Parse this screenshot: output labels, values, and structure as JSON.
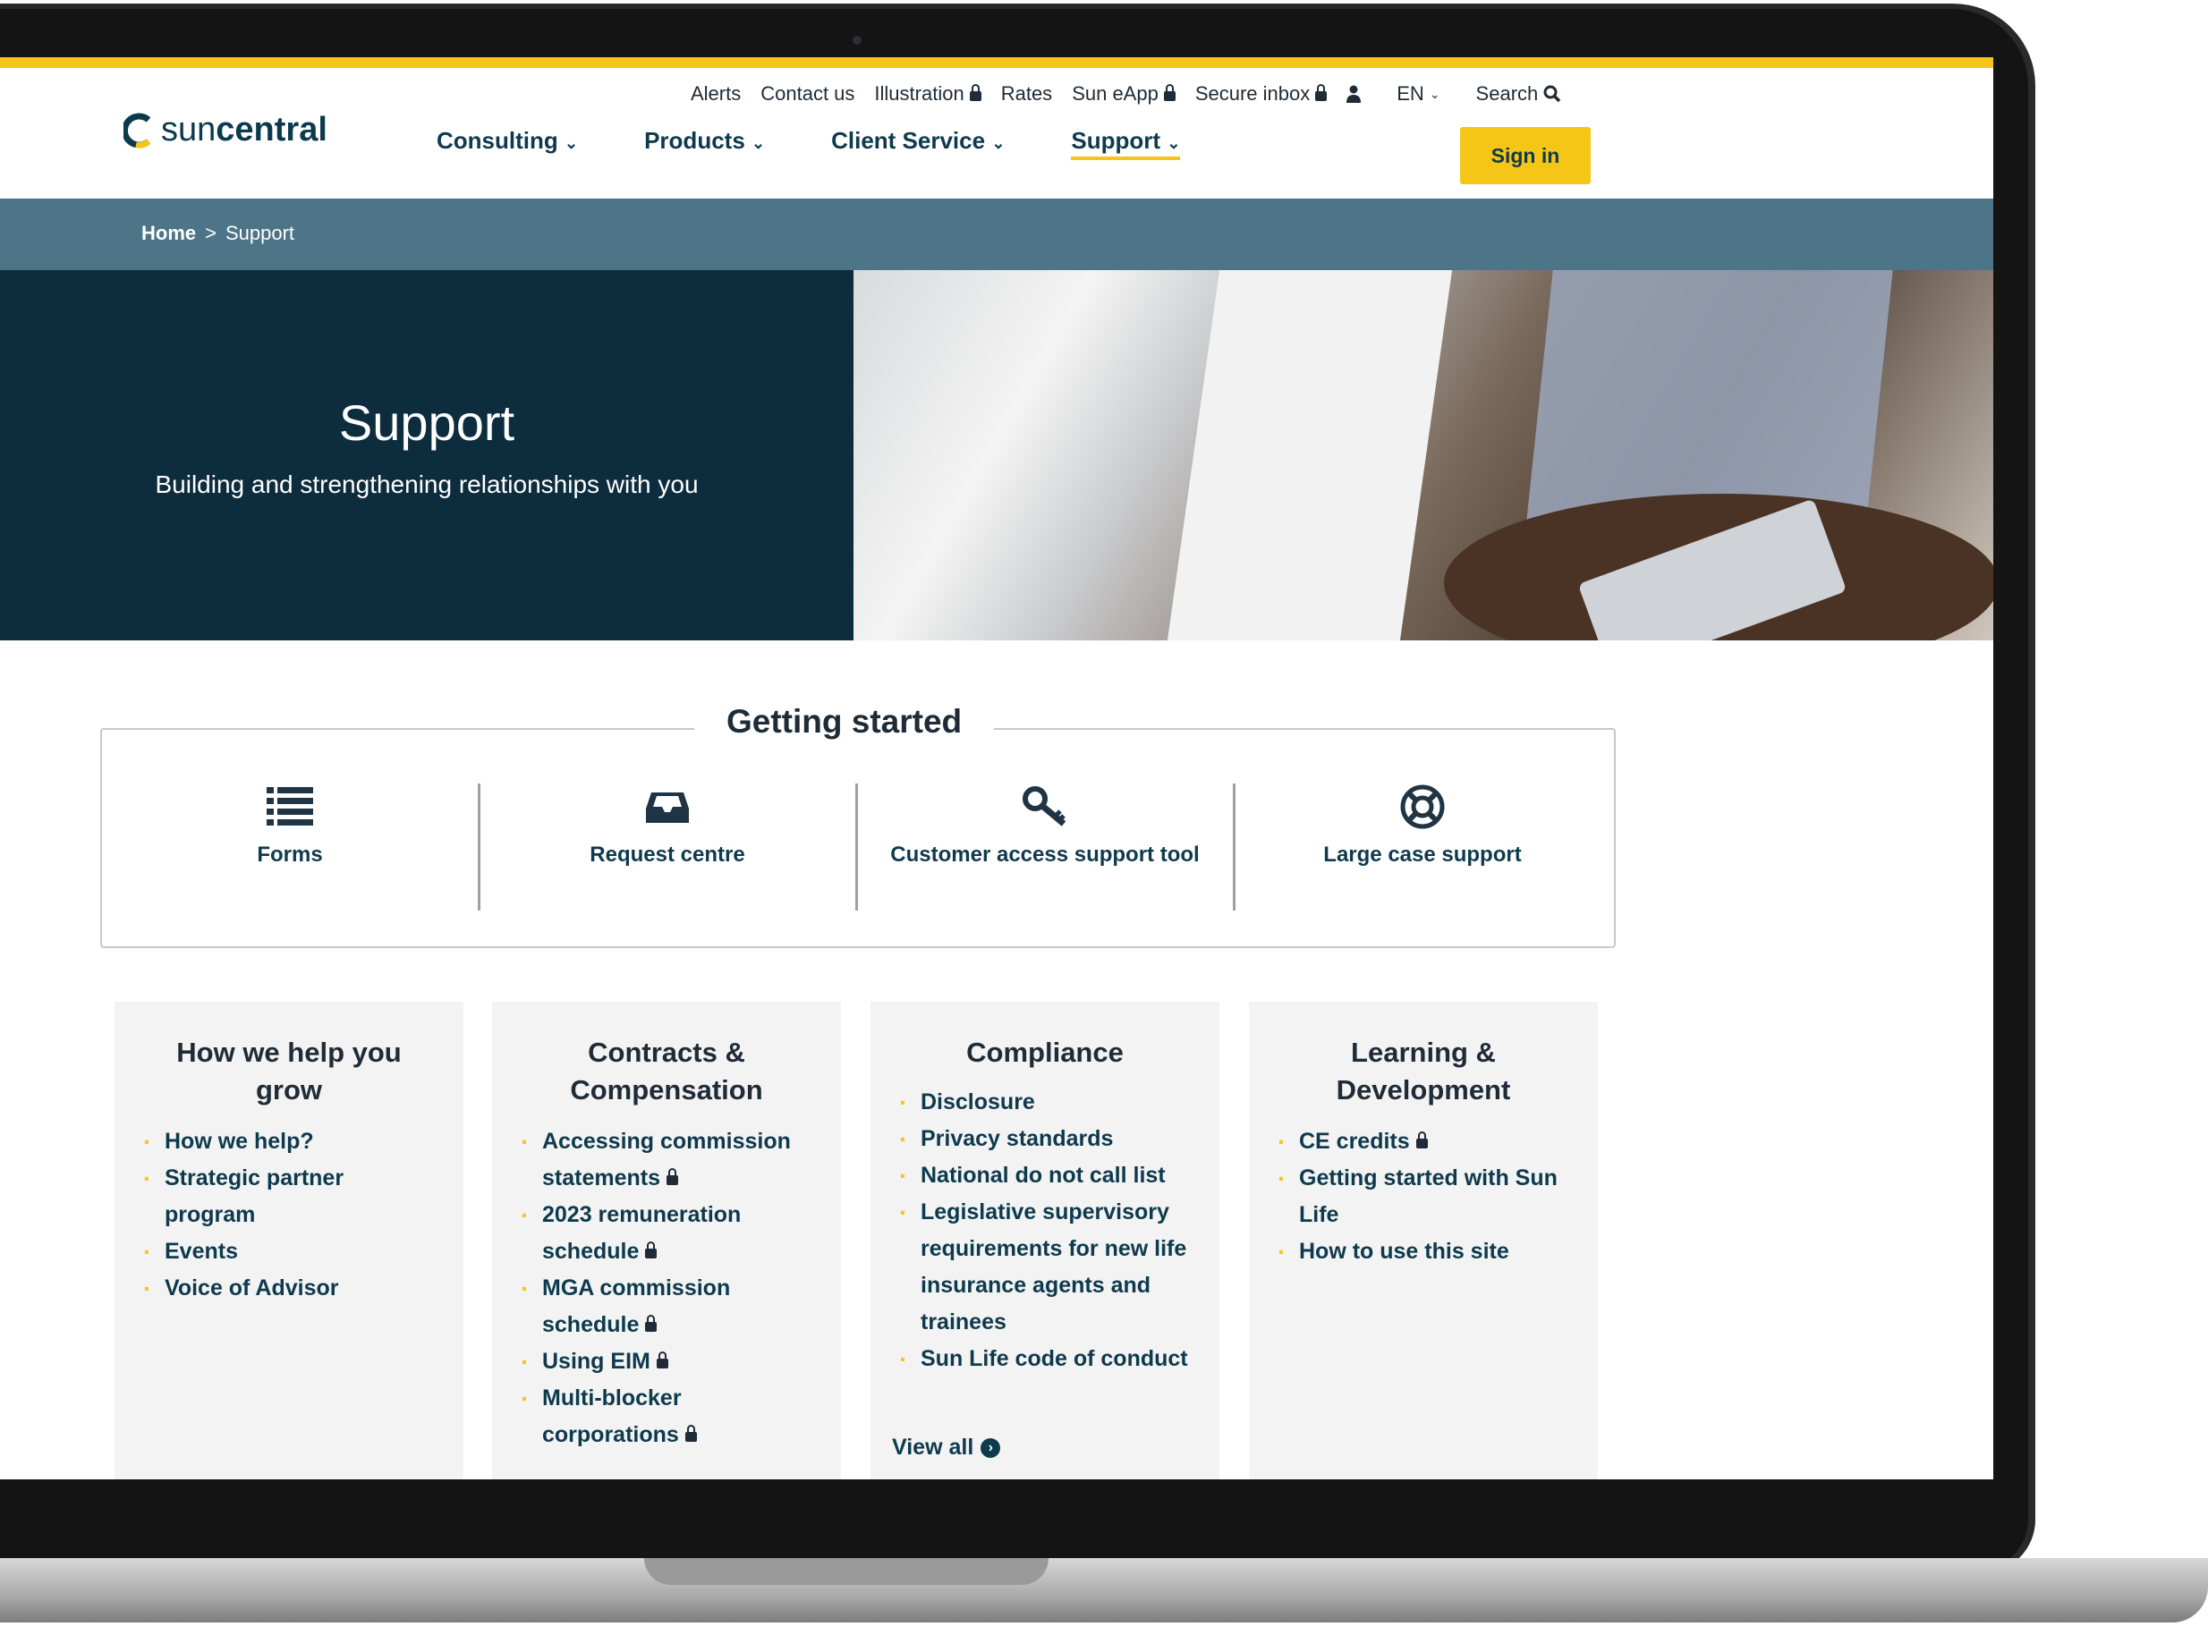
{
  "utility_nav": {
    "alerts": "Alerts",
    "contact_us": "Contact us",
    "illustration": "Illustration",
    "rates": "Rates",
    "sun_eapp": "Sun eApp",
    "secure_inbox": "Secure inbox",
    "language": "EN",
    "search": "Search"
  },
  "logo": {
    "prefix": "sun",
    "suffix": "central"
  },
  "main_nav": [
    "Consulting",
    "Products",
    "Client Service",
    "Support"
  ],
  "sign_in": "Sign in",
  "breadcrumb": {
    "home": "Home",
    "separator": ">",
    "current": "Support"
  },
  "hero": {
    "title": "Support",
    "subtitle": "Building and strengthening relationships with you"
  },
  "getting_started": {
    "title": "Getting started",
    "items": [
      "Forms",
      "Request centre",
      "Customer access support tool",
      "Large case support"
    ]
  },
  "cards": [
    {
      "title": "How we help you grow",
      "items": [
        "How we help?",
        "Strategic partner program",
        "Events",
        "Voice of Advisor"
      ]
    },
    {
      "title": "Contracts & Compensation",
      "items": [
        "Accessing commission statements",
        "2023 remuneration schedule",
        "MGA commission schedule",
        "Using EIM",
        "Multi-blocker corporations"
      ]
    },
    {
      "title": "Compliance",
      "items": [
        "Disclosure",
        "Privacy standards",
        "National do not call list",
        "Legislative supervisory requirements for new life insurance agents and trainees",
        "Sun Life code of conduct"
      ],
      "view_all": "View all"
    },
    {
      "title": "Learning & Development",
      "items": [
        "CE credits",
        "Getting started with Sun Life",
        "How to use this site"
      ]
    }
  ],
  "colors": {
    "accent": "#f5c518",
    "navy": "#0d2d3e",
    "breadcrumb_bg": "#4d7487"
  }
}
